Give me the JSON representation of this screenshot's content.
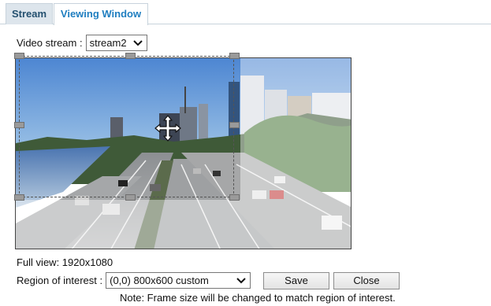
{
  "tabs": [
    {
      "label": "Stream",
      "active": false
    },
    {
      "label": "Viewing Window",
      "active": true
    }
  ],
  "video_stream": {
    "label": "Video stream :",
    "selected": "stream2"
  },
  "full_view": {
    "text": "Full view: 1920x1080"
  },
  "region_of_interest": {
    "label": "Region of interest :",
    "selected": "(0,0) 800x600 custom"
  },
  "buttons": {
    "save": "Save",
    "close": "Close"
  },
  "note": "Note: Frame size will be changed to match region of interest.",
  "icons": {
    "dropdown": "chevron-down-icon",
    "move": "move-arrows-icon",
    "resize_handle": "resize-handle-icon"
  },
  "colors": {
    "active_tab_text": "#1f7ec0",
    "inactive_tab_bg": "#dde5ec",
    "tab_border": "#c8d3dc"
  }
}
